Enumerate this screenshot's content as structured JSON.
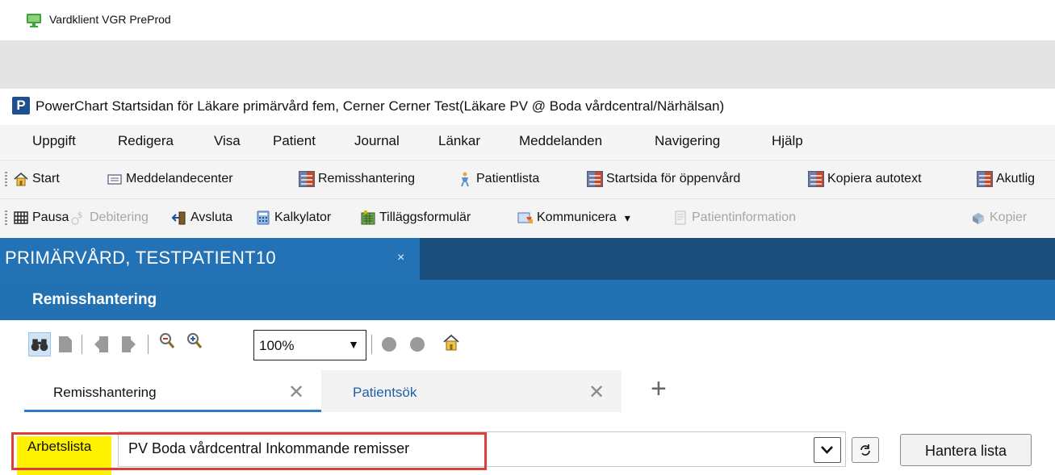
{
  "outer_window": {
    "title": "Vardklient VGR PreProd"
  },
  "window": {
    "title": "PowerChart Startsidan för Läkare primärvård fem, Cerner Cerner Test(Läkare PV @ Boda vårdcentral/Närhälsan)",
    "logo_letter": "P"
  },
  "menu": [
    "Uppgift",
    "Redigera",
    "Visa",
    "Patient",
    "Journal",
    "Länkar",
    "Meddelanden",
    "Navigering",
    "Hjälp"
  ],
  "toolbar1": [
    {
      "label": "Start",
      "icon": "home-icon"
    },
    {
      "label": "Meddelandecenter",
      "icon": "mail-icon"
    },
    {
      "label": "Remisshantering",
      "icon": "grid-icon"
    },
    {
      "label": "Patientlista",
      "icon": "person-icon"
    },
    {
      "label": "Startsida för öppenvård",
      "icon": "grid-icon"
    },
    {
      "label": "Kopiera autotext",
      "icon": "grid-icon"
    },
    {
      "label": "Akutlig",
      "icon": "grid-icon"
    }
  ],
  "toolbar2": [
    {
      "label": "Pausa",
      "icon": "pause-icon",
      "disabled": false
    },
    {
      "label": "Debitering",
      "icon": "billing-icon",
      "disabled": true
    },
    {
      "label": "Avsluta",
      "icon": "exit-icon",
      "disabled": false
    },
    {
      "label": "Kalkylator",
      "icon": "calculator-icon",
      "disabled": false
    },
    {
      "label": "Tilläggsformulär",
      "icon": "forms-icon",
      "disabled": false
    },
    {
      "label": "Kommunicera",
      "icon": "communicate-icon",
      "disabled": false,
      "dropdown": "▾"
    },
    {
      "label": "Patientinformation",
      "icon": "document-icon",
      "disabled": true
    },
    {
      "label": "Kopier",
      "icon": "copy-icon",
      "disabled": true
    }
  ],
  "patient_tab": {
    "name": "PRIMÄRVÅRD, TESTPATIENT10",
    "close": "×"
  },
  "section": {
    "title": "Remisshantering"
  },
  "inner_toolbar": {
    "zoom": "100%",
    "zoom_arrow": "▼"
  },
  "doc_tabs": [
    {
      "label": "Remisshantering",
      "close": "✕",
      "active": true
    },
    {
      "label": "Patientsök",
      "close": "✕",
      "active": false
    }
  ],
  "add_tab": "+",
  "worklist": {
    "label": "Arbetslista",
    "value": "PV Boda vårdcentral Inkommande remisser",
    "manage_label": "Hantera lista"
  },
  "colors": {
    "patient_bar": "#1b4f7b",
    "patient_tab": "#2372b5",
    "section_header": "#2171b3",
    "highlight": "#fff200",
    "annotation_box": "#e03c3c"
  }
}
